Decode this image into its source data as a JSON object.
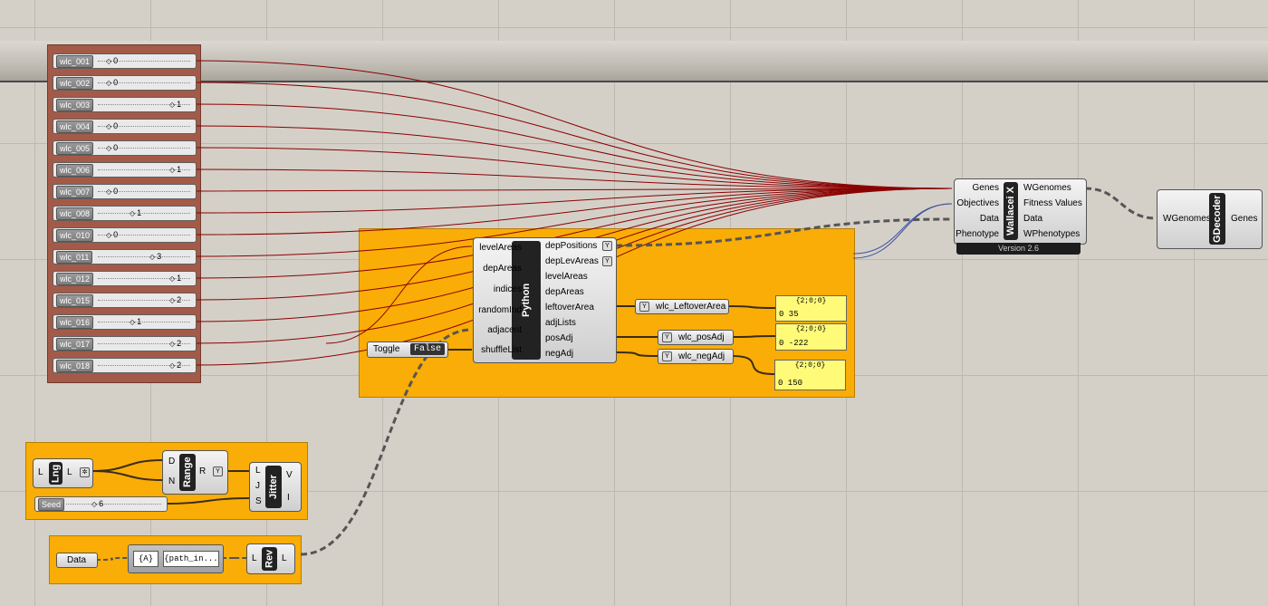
{
  "sliders": [
    {
      "label": "wlc_001",
      "value": "0",
      "pos": "left"
    },
    {
      "label": "wlc_002",
      "value": "0",
      "pos": "left"
    },
    {
      "label": "wlc_003",
      "value": "1",
      "pos": "right"
    },
    {
      "label": "wlc_004",
      "value": "0",
      "pos": "left"
    },
    {
      "label": "wlc_005",
      "value": "0",
      "pos": "left"
    },
    {
      "label": "wlc_006",
      "value": "1",
      "pos": "right"
    },
    {
      "label": "wlc_007",
      "value": "0",
      "pos": "left"
    },
    {
      "label": "wlc_008",
      "value": "1",
      "pos": "mid"
    },
    {
      "label": "wlc_010",
      "value": "0",
      "pos": "left"
    },
    {
      "label": "wlc_011",
      "value": "3",
      "pos": "mid2"
    },
    {
      "label": "wlc_012",
      "value": "1",
      "pos": "right"
    },
    {
      "label": "wlc_015",
      "value": "2",
      "pos": "right"
    },
    {
      "label": "wlc_016",
      "value": "1",
      "pos": "mid"
    },
    {
      "label": "wlc_017",
      "value": "2",
      "pos": "right"
    },
    {
      "label": "wlc_018",
      "value": "2",
      "pos": "right"
    }
  ],
  "wallacei": {
    "title": "Wallacei X",
    "inputs": [
      "Genes",
      "Objectives",
      "Data",
      "Phenotype"
    ],
    "outputs": [
      "WGenomes",
      "Fitness Values",
      "Data",
      "WPhenotypes"
    ],
    "version": "Version 2.6"
  },
  "gdecoder": {
    "title": "GDecoder",
    "input": "WGenomes",
    "output": "Genes"
  },
  "python": {
    "title": "Python",
    "inputs": [
      "levelAreas",
      "depAreas",
      "indices",
      "randomInd",
      "adjacent",
      "shuffleList"
    ],
    "outputs": [
      "depPositions",
      "depLevAreas",
      "levelAreas",
      "depAreas",
      "leftoverArea",
      "adjLists",
      "posAdj",
      "negAdj"
    ]
  },
  "toggle": {
    "label": "Toggle",
    "value": "False"
  },
  "relays": [
    {
      "label": "wlc_LeftoverArea"
    },
    {
      "label": "wlc_posAdj"
    },
    {
      "label": "wlc_negAdj"
    }
  ],
  "panels": [
    {
      "header": "{2;0;0}",
      "row": "0 35"
    },
    {
      "header": "{2;0;0}",
      "row": "0 -222"
    },
    {
      "header": "{2;0;0}",
      "row": "0 150"
    }
  ],
  "lng": {
    "title": "Lng",
    "in": "L",
    "out": "L"
  },
  "range": {
    "title": "Range",
    "inputs": [
      "D",
      "N"
    ],
    "output": "R"
  },
  "jitter": {
    "title": "Jitter",
    "inputs": [
      "L",
      "J",
      "S"
    ],
    "outputs": [
      "V",
      "I"
    ]
  },
  "seed": {
    "label": "Seed",
    "value": "6"
  },
  "data_param": {
    "label": "Data"
  },
  "path_mapper": {
    "left": "{A}",
    "right": "{path_in..."
  },
  "rev": {
    "title": "Rev",
    "in": "L",
    "out": "L"
  },
  "colors": {
    "group": "#f9ad06",
    "slider_group": "#a35a48",
    "wire_red": "#8b0000",
    "wire_dark": "#3a2c1a",
    "wire_blue": "#3d4f9e",
    "panel": "#fffb78"
  }
}
